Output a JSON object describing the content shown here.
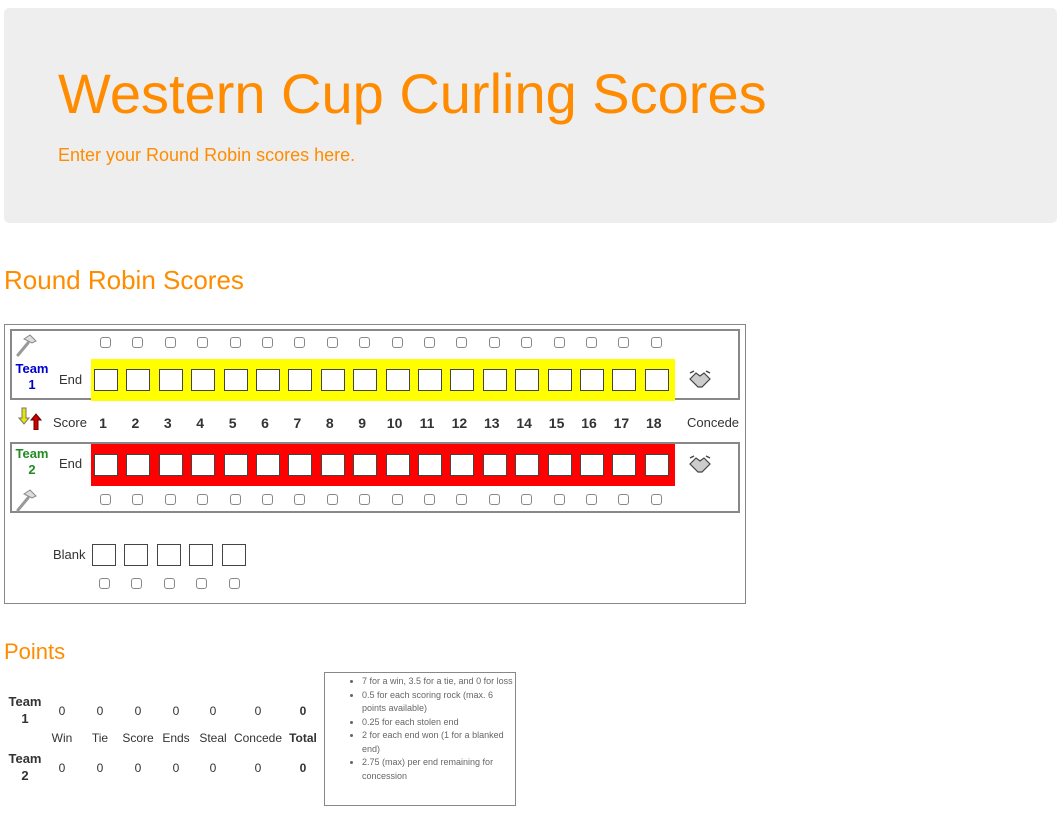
{
  "header": {
    "title": "Western Cup Curling Scores",
    "subtitle": "Enter your Round Robin scores here."
  },
  "round_robin": {
    "title": "Round Robin Scores",
    "team1": {
      "name_line1": "Team",
      "name_line2": "1",
      "color": "#0000cc",
      "band_color": "#ffff00"
    },
    "team2": {
      "name_line1": "Team",
      "name_line2": "2",
      "color": "#228b22",
      "band_color": "#ff0000"
    },
    "end_label": "End",
    "score_label": "Score",
    "concede_label": "Concede",
    "blank_label": "Blank",
    "ends": [
      "1",
      "2",
      "3",
      "4",
      "5",
      "6",
      "7",
      "8",
      "9",
      "10",
      "11",
      "12",
      "13",
      "14",
      "15",
      "16",
      "17",
      "18"
    ],
    "blank_count": 5
  },
  "points": {
    "title": "Points",
    "columns": [
      "Win",
      "Tie",
      "Score",
      "Ends",
      "Steal",
      "Concede",
      "Total"
    ],
    "team1": {
      "name_line1": "Team",
      "name_line2": "1",
      "values": [
        "0",
        "0",
        "0",
        "0",
        "0",
        "0",
        "0"
      ]
    },
    "team2": {
      "name_line1": "Team",
      "name_line2": "2",
      "values": [
        "0",
        "0",
        "0",
        "0",
        "0",
        "0",
        "0"
      ]
    },
    "rules": [
      "7 for a win, 3.5 for a tie, and 0 for loss",
      "0.5 for each scoring rock (max. 6 points available)",
      "0.25 for each stolen end",
      "2 for each end won (1 for a blanked end)",
      "2.75 (max) per end remaining for concession"
    ]
  }
}
